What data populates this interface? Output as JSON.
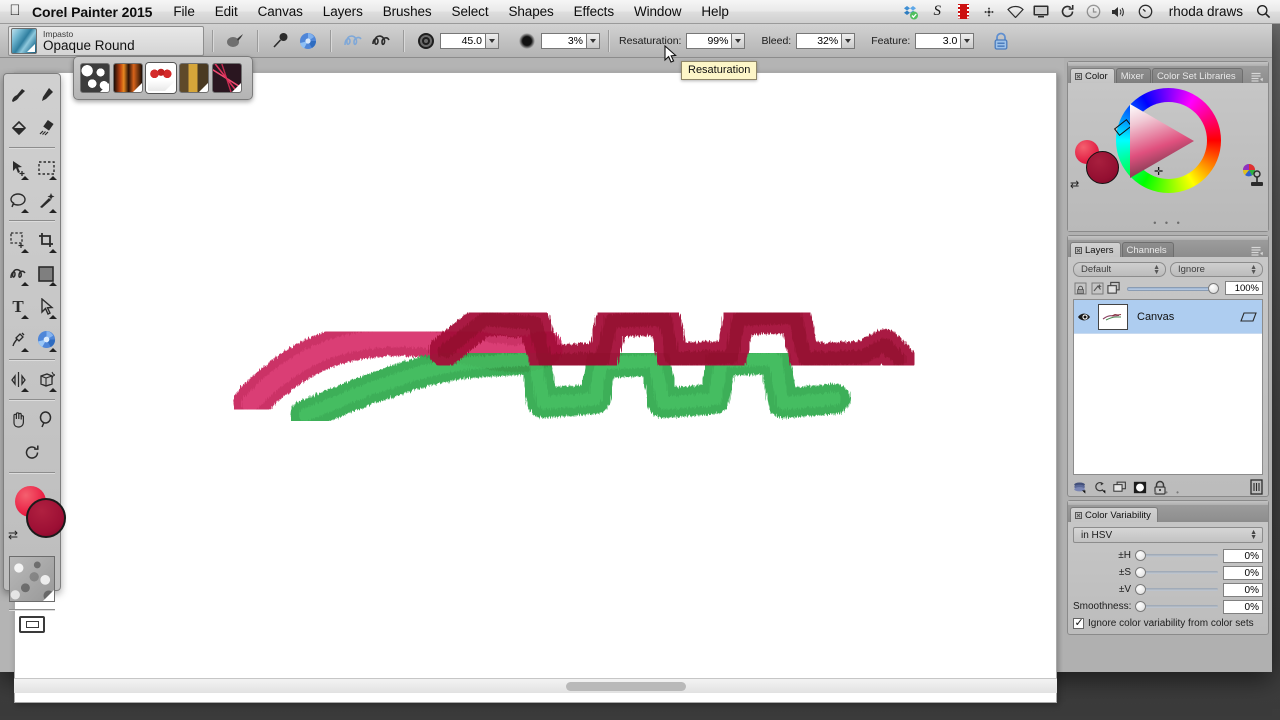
{
  "menubar": {
    "apple_icon": "apple-logo-icon",
    "app_title": "Corel Painter 2015",
    "items": [
      "File",
      "Edit",
      "Canvas",
      "Layers",
      "Brushes",
      "Select",
      "Shapes",
      "Effects",
      "Window",
      "Help"
    ],
    "status_icons": [
      "dropbox-icon",
      "scrivener-icon",
      "screenflow-icon",
      "airplay-icon",
      "wifi-icon",
      "display-icon",
      "sync-icon",
      "timemachine-icon",
      "volume-icon",
      "clock-icon"
    ],
    "user": "rhoda draws",
    "search_icon": "spotlight-search-icon"
  },
  "propbar": {
    "brush_category": "Impasto",
    "brush_variant": "Opaque Round",
    "icons": [
      "brush-selector-icon",
      "dropper-icon",
      "media-selector-icon",
      "stroke-trail-icon",
      "stroke-record-icon"
    ],
    "size_icon": "brush-size-icon",
    "size_value": "45.0",
    "opacity_icon": "brush-opacity-icon",
    "opacity_value": "3%",
    "resaturation_label": "Resaturation:",
    "resaturation_value": "99%",
    "bleed_label": "Bleed:",
    "bleed_value": "32%",
    "feature_label": "Feature:",
    "feature_value": "3.0",
    "lock_icon": "lock-icon"
  },
  "tooltip": {
    "text": "Resaturation"
  },
  "variant_strip": {
    "items": [
      {
        "name": "variant-confetti",
        "selected": false
      },
      {
        "name": "variant-stripes",
        "selected": false
      },
      {
        "name": "variant-tulips",
        "selected": true
      },
      {
        "name": "variant-plaid",
        "selected": false
      },
      {
        "name": "variant-fan",
        "selected": false
      }
    ]
  },
  "toolbox": {
    "tools": [
      "brush-tool",
      "dropper-tool",
      "paint-bucket-tool",
      "eraser-tool",
      "layer-adjuster-tool",
      "rectangular-selection-tool",
      "lasso-tool",
      "magic-wand-tool",
      "selection-adjuster-tool",
      "crop-tool",
      "freehand-shape-tool",
      "rectangular-shape-tool",
      "text-tool",
      "shape-selection-tool",
      "pen-tool",
      "media-selector-tool",
      "mirror-painting-tool",
      "perspective-guides-tool",
      "grabber-tool",
      "magnifier-tool",
      "rotate-page-tool"
    ],
    "color_front": "#e01a41",
    "color_back": "#930f31",
    "swap_icon": "swap-colors-icon",
    "paper_icon": "paper-texture-swatch",
    "screenmode_icon": "screen-mode-icon"
  },
  "canvas": {
    "background": "#ffffff",
    "scroll_position": "center",
    "strokes": [
      {
        "name": "pink-magenta-stroke",
        "color": "#c8265e"
      },
      {
        "name": "green-stroke",
        "color": "#2aa84a"
      },
      {
        "name": "dark-crimson-stroke",
        "color": "#a41238"
      }
    ]
  },
  "color_panel": {
    "tabs": [
      "Color",
      "Mixer",
      "Color Set Libraries"
    ],
    "active_tab": "Color",
    "menu_icon": "panel-menu-icon",
    "wheel_icon": "color-wheel",
    "triangle_icon": "saturation-value-triangle",
    "front_color": "#e01a41",
    "back_color": "#930f31",
    "swap_icon": "swap-colors-icon",
    "clone_icon": "clone-color-icon",
    "dots": "• • •"
  },
  "layers_panel": {
    "tabs": [
      "Layers",
      "Channels"
    ],
    "active_tab": "Layers",
    "menu_icon": "panel-menu-icon",
    "blend_mode": "Default",
    "mask_mode": "Ignore",
    "lock_icon": "lock-layer-icon",
    "preserve_icon": "preserve-transparency-icon",
    "pickup_icon": "pick-up-underlying-color-icon",
    "opacity_value": "100%",
    "layers": [
      {
        "name": "Canvas",
        "visible": true,
        "selected": true,
        "thumb": "canvas-thumbnail"
      }
    ],
    "bottom_icons": [
      "dynamic-plugins-icon",
      "layer-mask-icon",
      "new-layer-icon",
      "new-layer-mask-icon",
      "lock-icon",
      "delete-layer-icon"
    ],
    "dots": "• • •"
  },
  "color_variability": {
    "tab": "Color Variability",
    "mode": "in HSV",
    "rows": [
      {
        "label": "±H",
        "value": "0%"
      },
      {
        "label": "±S",
        "value": "0%"
      },
      {
        "label": "±V",
        "value": "0%"
      },
      {
        "label": "Smoothness:",
        "value": "0%"
      }
    ],
    "checkbox_label": "Ignore color variability from color sets",
    "checkbox_checked": true
  }
}
